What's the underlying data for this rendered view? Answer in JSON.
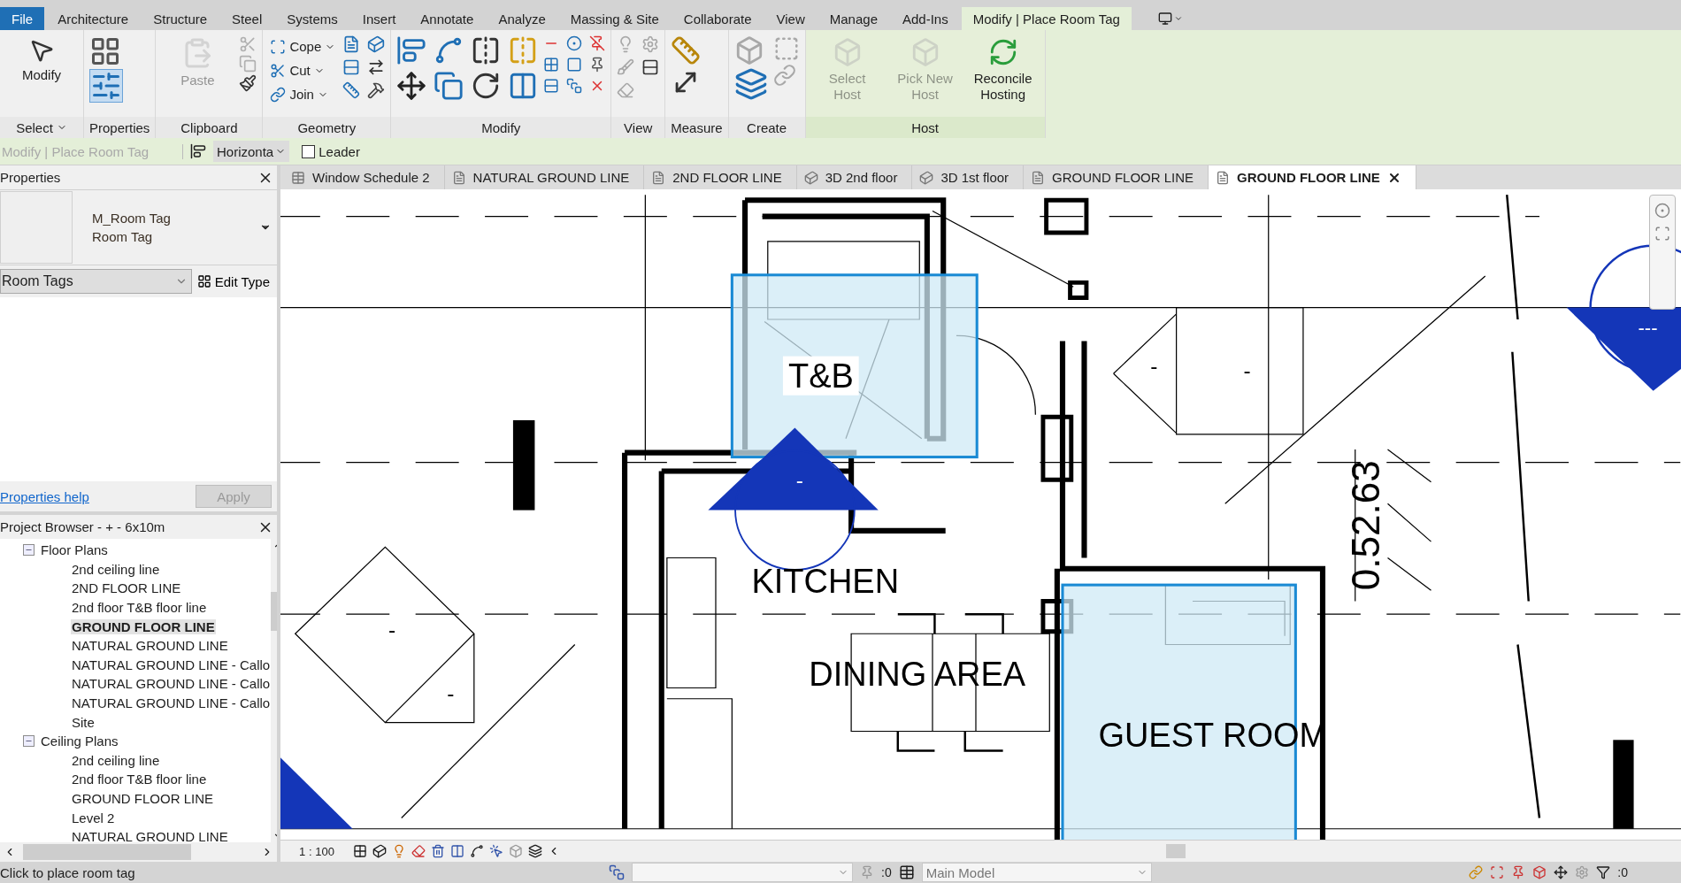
{
  "menu_tabs": [
    {
      "label": "File",
      "kind": "file",
      "selected": false
    },
    {
      "label": "Architecture",
      "kind": "tab",
      "selected": false
    },
    {
      "label": "Structure",
      "kind": "tab",
      "selected": false
    },
    {
      "label": "Steel",
      "kind": "tab",
      "selected": false
    },
    {
      "label": "Systems",
      "kind": "tab",
      "selected": false
    },
    {
      "label": "Insert",
      "kind": "tab",
      "selected": false
    },
    {
      "label": "Annotate",
      "kind": "tab",
      "selected": false
    },
    {
      "label": "Analyze",
      "kind": "tab",
      "selected": false
    },
    {
      "label": "Massing & Site",
      "kind": "tab",
      "selected": false
    },
    {
      "label": "Collaborate",
      "kind": "tab",
      "selected": false
    },
    {
      "label": "View",
      "kind": "tab",
      "selected": false
    },
    {
      "label": "Manage",
      "kind": "tab",
      "selected": false
    },
    {
      "label": "Add-Ins",
      "kind": "tab",
      "selected": false
    },
    {
      "label": "Modify | Place Room Tag",
      "kind": "tab",
      "selected": true
    }
  ],
  "ribbon": {
    "panels": [
      {
        "title": "Select",
        "kind": "select",
        "tools": [
          {
            "label": "Modify",
            "disabled": false
          }
        ]
      },
      {
        "title": "Properties",
        "kind": "properties"
      },
      {
        "title": "Clipboard",
        "kind": "clipboard",
        "tools": [
          {
            "label": "Paste",
            "disabled": true
          }
        ]
      },
      {
        "title": "Geometry",
        "kind": "geometry",
        "tools": [
          {
            "label": "Cope"
          },
          {
            "label": "Cut"
          },
          {
            "label": "Join"
          }
        ]
      },
      {
        "title": "Modify",
        "kind": "modify"
      },
      {
        "title": "View",
        "kind": "view"
      },
      {
        "title": "Measure",
        "kind": "measure"
      },
      {
        "title": "Create",
        "kind": "create"
      },
      {
        "title": "Host",
        "kind": "host",
        "tools": [
          {
            "label": "Select Host",
            "disabled": true
          },
          {
            "label": "Pick New Host",
            "disabled": true
          },
          {
            "label": "Reconcile Hosting",
            "disabled": false
          }
        ]
      }
    ]
  },
  "options_bar": {
    "context": "Modify | Place Room Tag",
    "orientation": "Horizonta",
    "leader": {
      "label": "Leader",
      "checked": false
    }
  },
  "properties": {
    "title": "Properties",
    "type_family": "M_Room Tag",
    "type_name": "Room Tag",
    "category": "Room Tags",
    "edit_type": "Edit Type",
    "help_link": "Properties help",
    "apply": "Apply"
  },
  "project_browser": {
    "title": "Project Browser - + - 6x10m",
    "tree": [
      {
        "label": "Floor Plans",
        "expanded": true,
        "children": [
          {
            "label": "2nd ceiling line",
            "selected": false
          },
          {
            "label": "2ND FLOOR LINE",
            "selected": false
          },
          {
            "label": "2nd floor T&B floor line",
            "selected": false
          },
          {
            "label": "GROUND FLOOR LINE",
            "selected": true
          },
          {
            "label": "NATURAL GROUND LINE",
            "selected": false
          },
          {
            "label": "NATURAL GROUND LINE - Callo",
            "selected": false
          },
          {
            "label": "NATURAL GROUND LINE - Callo",
            "selected": false
          },
          {
            "label": "NATURAL GROUND LINE - Callo",
            "selected": false
          },
          {
            "label": "Site",
            "selected": false
          }
        ]
      },
      {
        "label": "Ceiling Plans",
        "expanded": true,
        "children": [
          {
            "label": "2nd ceiling line",
            "selected": false
          },
          {
            "label": "2nd floor T&B floor line",
            "selected": false
          },
          {
            "label": "GROUND FLOOR LINE",
            "selected": false
          },
          {
            "label": "Level 2",
            "selected": false
          },
          {
            "label": "NATURAL GROUND LINE",
            "selected": false
          }
        ]
      }
    ]
  },
  "view_tabs": [
    {
      "label": "Window Schedule 2",
      "kind": "schedule",
      "selected": false
    },
    {
      "label": "NATURAL GROUND LINE",
      "kind": "plan",
      "selected": false
    },
    {
      "label": "2ND FLOOR LINE",
      "kind": "plan",
      "selected": false
    },
    {
      "label": "3D 2nd floor",
      "kind": "model",
      "selected": false
    },
    {
      "label": "3D 1st floor",
      "kind": "model",
      "selected": false
    },
    {
      "label": "GROUND FLOOR LINE",
      "kind": "plan",
      "selected": false
    },
    {
      "label": "GROUND FLOOR LINE",
      "kind": "plan",
      "selected": true
    }
  ],
  "drawing": {
    "room_labels": [
      "T&B",
      "KITCHEN",
      "DINING AREA",
      "GUEST ROOM"
    ],
    "dimension": "0.52.63",
    "tag_marks": [
      "-",
      "-",
      "-",
      "-",
      "-"
    ],
    "section_mark": "---"
  },
  "view_bar": {
    "scale": "1 : 100"
  },
  "status_bar": {
    "message": "Click to place room tag",
    "selection_count": ":0",
    "model": "Main Model",
    "filter_count": ":0"
  }
}
